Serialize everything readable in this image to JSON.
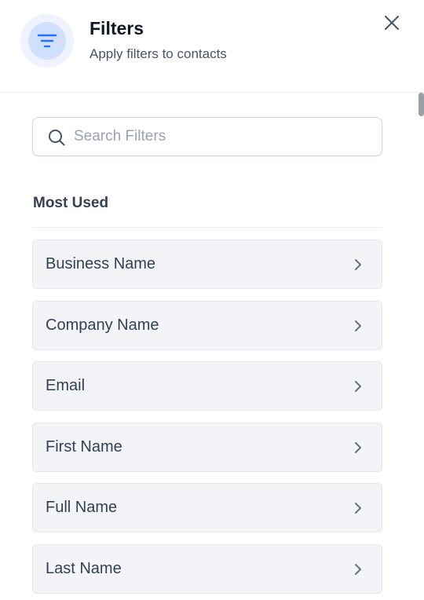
{
  "header": {
    "title": "Filters",
    "subtitle": "Apply filters to contacts",
    "icon": "filter-lines-icon",
    "close_icon": "close-icon"
  },
  "search": {
    "placeholder": "Search Filters",
    "value": "",
    "icon": "search-icon"
  },
  "section": {
    "title": "Most Used"
  },
  "filters": [
    {
      "label": "Business Name"
    },
    {
      "label": "Company Name"
    },
    {
      "label": "Email"
    },
    {
      "label": "First Name"
    },
    {
      "label": "Full Name"
    },
    {
      "label": "Last Name"
    }
  ],
  "colors": {
    "accent": "#2970ff",
    "icon_bg_outer": "#eef3ff",
    "icon_bg_inner": "#d1e0ff",
    "item_bg": "#f2f4f7",
    "text_primary": "#101828",
    "text_secondary": "#475467"
  }
}
